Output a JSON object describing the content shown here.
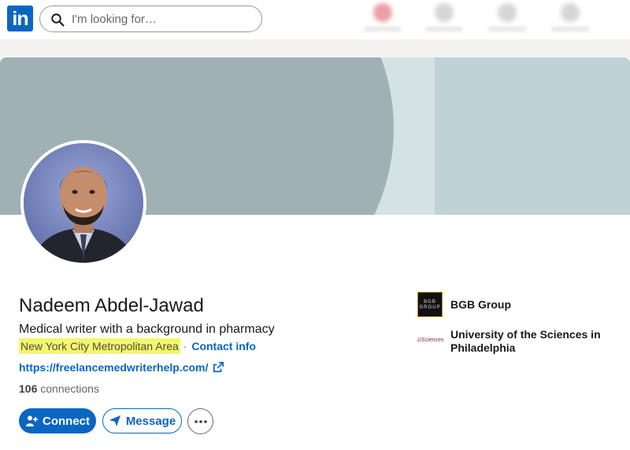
{
  "nav": {
    "logo_text": "in",
    "search_placeholder": "I'm looking for…"
  },
  "profile": {
    "name": "Nadeem Abdel-Jawad",
    "headline": "Medical writer with a background in pharmacy",
    "location": "New York City Metropolitan Area",
    "separator": "·",
    "contact_label": "Contact info",
    "website": "https://freelancemedwriterhelp.com/",
    "connections_count": "106",
    "connections_label": "connections"
  },
  "actions": {
    "connect_label": "Connect",
    "message_label": "Message",
    "more_icon": "ellipsis-icon"
  },
  "orgs": [
    {
      "name": "BGB Group",
      "logo_text": "BGB GROUP"
    },
    {
      "name": "University of the Sciences in Philadelphia",
      "logo_text": "USciences"
    }
  ],
  "colors": {
    "brand": "#0a66c2",
    "highlight": "#f5f76a",
    "banner_dark": "#9fb1b3",
    "banner_light": "#bfd2d6"
  }
}
